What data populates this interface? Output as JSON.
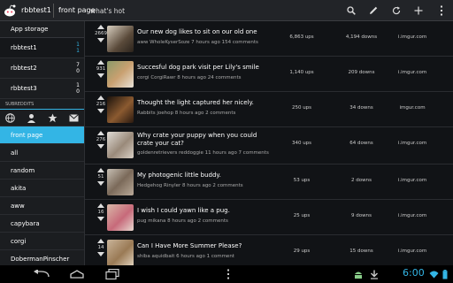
{
  "actionbar": {
    "account": "rbbtest1",
    "section": "front page",
    "subsection": "what's hot"
  },
  "sidebar": {
    "storage_label": "App storage",
    "accounts": [
      {
        "name": "rbbtest1",
        "top": "1",
        "bottom": "1"
      },
      {
        "name": "rbbtest2",
        "top": "7",
        "bottom": "0"
      },
      {
        "name": "rbbtest3",
        "top": "1",
        "bottom": "0"
      }
    ],
    "subreddits_header": "SUBREDDITS",
    "subreddits": [
      "front page",
      "all",
      "random",
      "akita",
      "aww",
      "capybara",
      "corgi",
      "DobermanPinscher"
    ]
  },
  "posts": [
    {
      "score": "2669",
      "title": "Our new dog likes to sit on our old one",
      "meta": "aww WholeKyserSoze 7 hours ago 154 comments",
      "ups": "6,863 ups",
      "downs": "4,194 downs",
      "domain": "i.imgur.com"
    },
    {
      "score": "931",
      "title": "Succesful dog park visit per Lily's smile",
      "meta": "corgi CorgiRawr 8 hours ago 24 comments",
      "ups": "1,140 ups",
      "downs": "209 downs",
      "domain": "i.imgur.com"
    },
    {
      "score": "216",
      "title": "Thought the light captured her nicely.",
      "meta": "Rabbits joehop 8 hours ago 2 comments",
      "ups": "250 ups",
      "downs": "34 downs",
      "domain": "imgur.com"
    },
    {
      "score": "276",
      "title": "Why crate your puppy when you could crate your cat?",
      "meta": "goldenretrievers reddoggie 11 hours ago 7 comments",
      "ups": "340 ups",
      "downs": "64 downs",
      "domain": "i.imgur.com"
    },
    {
      "score": "51",
      "title": "My photogenic little buddy.",
      "meta": "Hedgehog Rinyler 8 hours ago 2 comments",
      "ups": "53 ups",
      "downs": "2 downs",
      "domain": "i.imgur.com"
    },
    {
      "score": "16",
      "title": "I wish I could yawn like a pug.",
      "meta": "pug mikana 8 hours ago 2 comments",
      "ups": "25 ups",
      "downs": "9 downs",
      "domain": "i.imgur.com"
    },
    {
      "score": "14",
      "title": "Can I Have More Summer Please?",
      "meta": "shiba aquidbait 6 hours ago 1 comment",
      "ups": "29 ups",
      "downs": "15 downs",
      "domain": "i.imgur.com"
    }
  ],
  "statusbar": {
    "time": "6:00"
  },
  "colors": {
    "accent": "#33b5e5",
    "background": "#111316"
  }
}
